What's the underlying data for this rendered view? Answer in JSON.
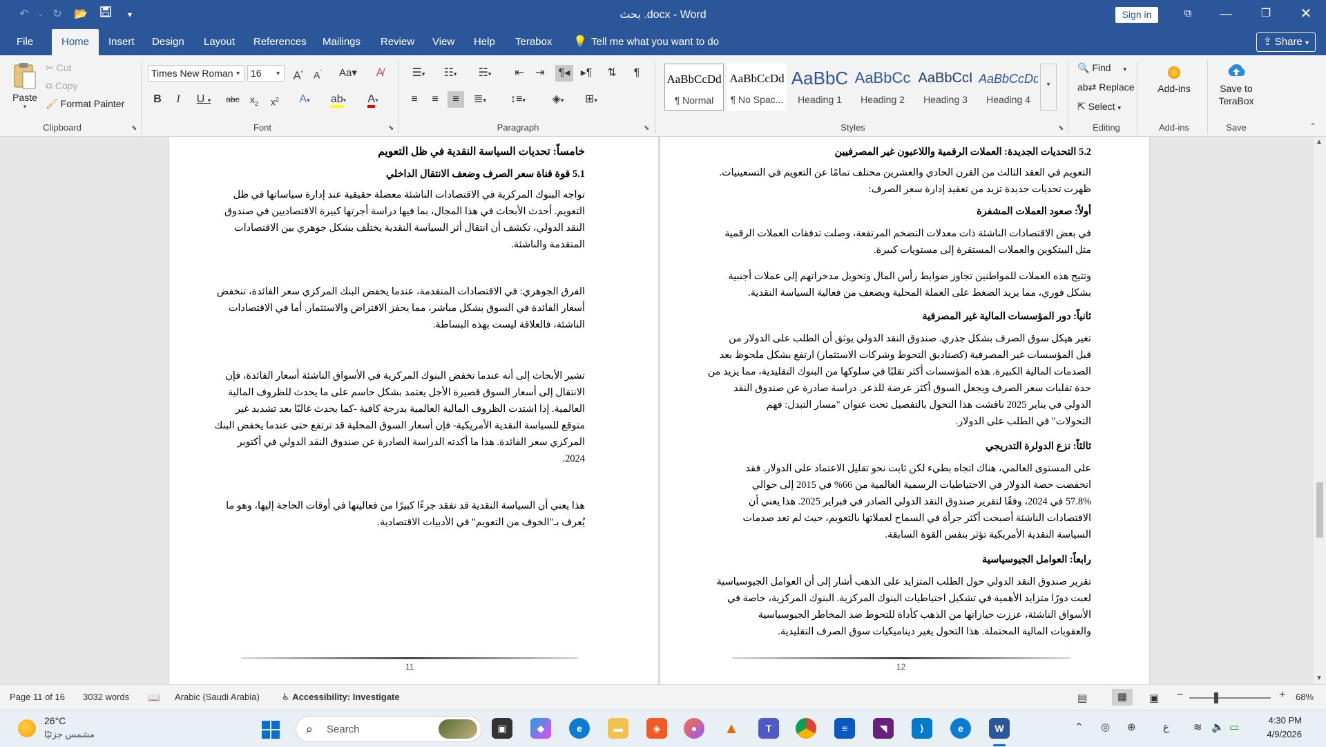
{
  "window": {
    "title": "بحث .docx - Word",
    "signin_label": "Sign in",
    "share_label": "Share"
  },
  "menu": {
    "tabs": [
      "File",
      "Home",
      "Insert",
      "Design",
      "Layout",
      "References",
      "Mailings",
      "Review",
      "View",
      "Help",
      "Terabox"
    ],
    "tell_me": "Tell me what you want to do"
  },
  "ribbon": {
    "clipboard": {
      "paste": "Paste",
      "cut": "Cut",
      "copy": "Copy",
      "format_painter": "Format Painter",
      "label": "Clipboard"
    },
    "font": {
      "name": "Times New Roman",
      "size": "16",
      "label": "Font"
    },
    "paragraph": {
      "label": "Paragraph"
    },
    "styles": {
      "label": "Styles",
      "items": [
        {
          "preview": "AaBbCcDd",
          "name": "¶ Normal"
        },
        {
          "preview": "AaBbCcDd",
          "name": "¶ No Spac..."
        },
        {
          "preview": "AaBbC",
          "name": "Heading 1"
        },
        {
          "preview": "AaBbCc",
          "name": "Heading 2"
        },
        {
          "preview": "AaBbCcI",
          "name": "Heading 3"
        },
        {
          "preview": "AaBbCcDd",
          "name": "Heading 4"
        }
      ]
    },
    "editing": {
      "find": "Find",
      "replace": "Replace",
      "select": "Select",
      "label": "Editing"
    },
    "addins": {
      "button": "Add-ins",
      "label": "Add-ins"
    },
    "save": {
      "button_line1": "Save to",
      "button_line2": "TeraBox",
      "label": "Save"
    }
  },
  "pages": {
    "left": {
      "heading": "خامساً: تحديات السياسة النقدية في ظل التعويم",
      "subheading": "5.1 قوة قناة سعر الصرف وضعف الانتقال الداخلي",
      "p1": [
        "تواجه البنوك المركزية في الاقتصادات الناشئة معضلة حقيقية عند إدارة سياساتها في ظل",
        "التعويم. أحدث الأبحاث في هذا المجال، بما فيها دراسة أجرتها كبيرة الاقتصاديين في صندوق",
        "النقد الدولي، تكشف أن انتقال أثر السياسة النقدية يختلف بشكل جوهري بين الاقتصادات",
        "المتقدمة والناشئة."
      ],
      "p2": [
        "الفرق الجوهري: في الاقتصادات المتقدمة، عندما يخفض البنك المركزي سعر الفائدة، تنخفض",
        "أسعار الفائدة في السوق بشكل مباشر، مما يحفز الاقتراض والاستثمار. أما في الاقتصادات",
        "الناشئة، فالعلاقة ليست بهذه البساطة."
      ],
      "p3": [
        "تشير الأبحاث إلى أنه عندما تخفض البنوك المركزية في الأسواق الناشئة أسعار الفائدة، فإن",
        "الانتقال إلى أسعار السوق قصيرة الأجل يعتمد بشكل حاسم على ما يحدث للظروف المالية",
        "العالمية. إذا اشتدت الظروف المالية العالمية بدرجة كافية -كما يحدث غالبًا بعد تشديد غير",
        "متوقع للسياسة النقدية الأمريكية- فإن أسعار السوق المحلية قد ترتفع حتى عندما يخفض البنك",
        "المركزي سعر الفائدة. هذا ما أكدته الدراسة الصادرة عن صندوق النقد الدولي في أكتوبر",
        "2024."
      ],
      "p4": [
        "هذا يعني أن السياسة النقدية قد تفقد جزءًا كبيرًا من فعاليتها في أوقات الحاجة إليها، وهو ما",
        "يُعرف بـ\"الخوف من التعويم\" في الأدبيات الاقتصادية."
      ],
      "page_number": "11"
    },
    "right": {
      "heading": "5.2 التحديات الجديدة: العملات الرقمية واللاعبون غير المصرفيين",
      "intro": [
        "التعويم في العقد الثالث من القرن الحادي والعشرين مختلف تمامًا عن التعويم في التسعينيات.",
        "ظهرت تحديات جديدة تزيد من تعقيد إدارة سعر الصرف:"
      ],
      "s1_title": "أولاً: صعود العملات المشفرة",
      "s1_p1": [
        "في بعض الاقتصادات الناشئة ذات معدلات التضخم المرتفعة، وصلت تدفقات العملات الرقمية",
        "مثل البيتكوين والعملات المستقرة إلى مستويات كبيرة."
      ],
      "s1_p2": [
        "وتتيح هذه العملات للمواطنين تجاوز ضوابط رأس المال وتحويل مدخراتهم إلى عملات أجنبية",
        "بشكل فوري، مما يزيد الضغط على العملة المحلية ويضعف من فعالية السياسة النقدية."
      ],
      "s2_title": "ثانياً: دور المؤسسات المالية غير المصرفية",
      "s2_p": [
        "تغير هيكل سوق الصرف بشكل جذري. صندوق النقد الدولي يوثق أن الطلب على الدولار من",
        "قبل المؤسسات غير المصرفية (كصناديق التحوط وشركات الاستثمار) ارتفع بشكل ملحوظ بعد",
        "الصدمات المالية الكبيرة. هذه المؤسسات أكثر تقلبًا في سلوكها من البنوك التقليدية، مما يزيد من",
        "حدة تقلبات سعر الصرف ويجعل السوق أكثر عرضة للذعر. دراسة صادرة عن صندوق النقد",
        "الدولي في يناير 2025 ناقشت هذا التحول بالتفصيل تحت عنوان \"مسار التبدل: فهم",
        "التحولات\" في الطلب على الدولار."
      ],
      "s3_title": "ثالثاً: نزع الدولرة التدريجي",
      "s3_p": [
        "على المستوى العالمي، هناك اتجاه بطيء لكن ثابت نحو تقليل الاعتماد على الدولار. فقد",
        "انخفضت حصة الدولار في الاحتياطيات الرسمية العالمية من 66% في 2015 إلى حوالي",
        "57.8% في 2024، وفقًا لتقرير صندوق النقد الدولي الصادر في فبراير 2025. هذا يعني أن",
        "الاقتصادات الناشئة أصبحت أكثر جرأة في السماح لعملاتها بالتعويم، حيث لم تعد صدمات",
        "السياسة النقدية الأمريكية تؤثر بنفس القوة السابقة."
      ],
      "s4_title": "رابعاً: العوامل الجيوسياسية",
      "s4_p": [
        "تقرير صندوق النقد الدولي حول الطلب المتزايد على الذهب أشار إلى أن العوامل الجيوسياسية",
        "لعبت دورًا متزايد الأهمية في تشكيل احتياطيات البنوك المركزية. البنوك المركزية، خاصة في",
        "الأسواق الناشئة، عززت حيازاتها من الذهب كأداة للتحوط ضد المخاطر الجيوسياسية",
        "والعقوبات المالية المحتملة. هذا التحول يغير ديناميكيات سوق الصرف التقليدية."
      ],
      "page_number": "12"
    }
  },
  "status": {
    "page": "Page 11 of 16",
    "words": "3032 words",
    "language": "Arabic (Saudi Arabia)",
    "accessibility": "Accessibility: Investigate",
    "zoom": "68%"
  },
  "taskbar": {
    "temperature": "26°C",
    "weather": "مشمس جزئيًا",
    "search_placeholder": "Search",
    "time": "4:30 PM",
    "date": "4/9/2026",
    "input_lang": "ع"
  },
  "colors": {
    "word_blue": "#2b579a",
    "ribbon_bg": "#f3f3f3",
    "canvas_bg": "#e6e6e6"
  }
}
